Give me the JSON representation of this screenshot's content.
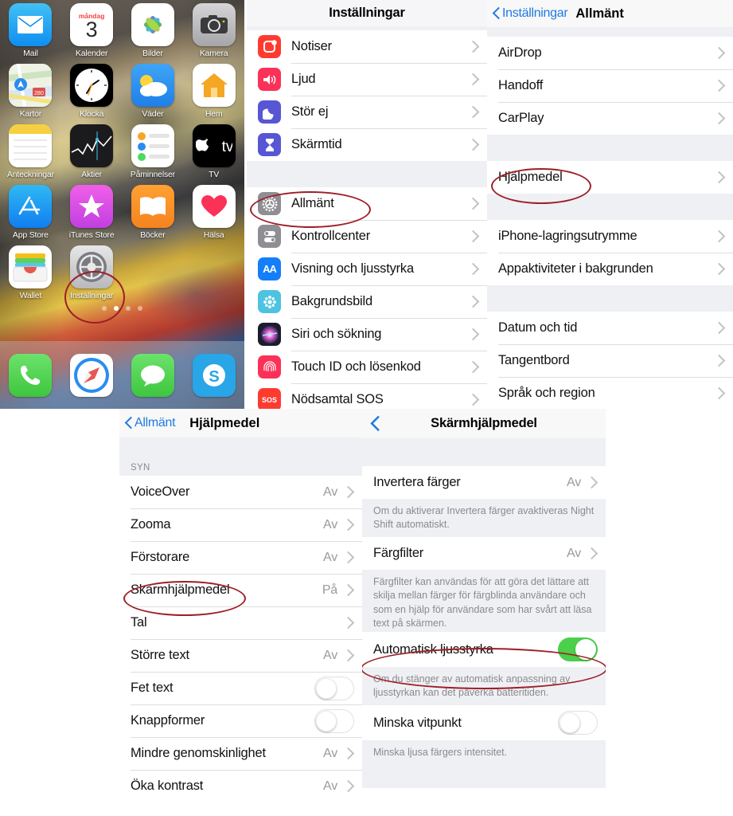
{
  "homescreen": {
    "wallpaper_desc": "photo of a colorful painted van",
    "rows": [
      [
        {
          "label": "Mail",
          "icon": "mail-icon"
        },
        {
          "label": "Kalender",
          "icon": "calendar-icon",
          "weekday": "måndag",
          "day": "3"
        },
        {
          "label": "Bilder",
          "icon": "photos-icon"
        },
        {
          "label": "Kamera",
          "icon": "camera-icon"
        }
      ],
      [
        {
          "label": "Kartor",
          "icon": "maps-icon"
        },
        {
          "label": "Klocka",
          "icon": "clock-icon"
        },
        {
          "label": "Väder",
          "icon": "weather-icon"
        },
        {
          "label": "Hem",
          "icon": "home-icon"
        }
      ],
      [
        {
          "label": "Anteckningar",
          "icon": "notes-icon"
        },
        {
          "label": "Aktier",
          "icon": "stocks-icon"
        },
        {
          "label": "Påminnelser",
          "icon": "reminders-icon"
        },
        {
          "label": "TV",
          "icon": "tv-icon"
        }
      ],
      [
        {
          "label": "App Store",
          "icon": "appstore-icon"
        },
        {
          "label": "iTunes Store",
          "icon": "itunes-icon"
        },
        {
          "label": "Böcker",
          "icon": "books-icon"
        },
        {
          "label": "Hälsa",
          "icon": "health-icon"
        }
      ],
      [
        {
          "label": "Wallet",
          "icon": "wallet-icon"
        },
        {
          "label": "Inställningar",
          "icon": "settings-gear-icon"
        },
        {
          "label": "",
          "icon": "empty-slot"
        },
        {
          "label": "",
          "icon": "empty-slot"
        }
      ]
    ],
    "page_dots": 4,
    "active_dot": 2,
    "dock": [
      {
        "label": "Telefon",
        "icon": "phone-icon"
      },
      {
        "label": "Safari",
        "icon": "safari-icon"
      },
      {
        "label": "Meddelanden",
        "icon": "messages-icon"
      },
      {
        "label": "Skype",
        "icon": "skype-icon"
      }
    ]
  },
  "settings": {
    "title": "Inställningar",
    "groups": [
      {
        "rows": [
          {
            "label": "Notiser",
            "icon": "notifications-icon",
            "color": "#ff3b30"
          },
          {
            "label": "Ljud",
            "icon": "sounds-icon",
            "color": "#fc3158"
          },
          {
            "label": "Stör ej",
            "icon": "do-not-disturb-icon",
            "color": "#5756d5"
          },
          {
            "label": "Skärmtid",
            "icon": "screen-time-icon",
            "color": "#5756d5"
          }
        ]
      },
      {
        "rows": [
          {
            "label": "Allmänt",
            "icon": "general-gear-icon",
            "color": "#8e8e93",
            "highlighted": true
          },
          {
            "label": "Kontrollcenter",
            "icon": "control-center-icon",
            "color": "#8e8e93"
          },
          {
            "label": "Visning och ljusstyrka",
            "icon": "display-brightness-icon",
            "color": "#147efb"
          },
          {
            "label": "Bakgrundsbild",
            "icon": "wallpaper-icon",
            "color": "#4cc3e0"
          },
          {
            "label": "Siri och sökning",
            "icon": "siri-icon",
            "color": "#1c1c2e"
          },
          {
            "label": "Touch ID och lösenkod",
            "icon": "touch-id-icon",
            "color": "#fc3158"
          },
          {
            "label": "Nödsamtal SOS",
            "icon": "sos-icon",
            "color": "#ff3b30"
          }
        ]
      }
    ]
  },
  "general": {
    "back_label": "Inställningar",
    "title": "Allmänt",
    "groups": [
      {
        "rows": [
          {
            "label": "AirDrop"
          },
          {
            "label": "Handoff"
          },
          {
            "label": "CarPlay"
          }
        ]
      },
      {
        "rows": [
          {
            "label": "Hjälpmedel",
            "highlighted": true
          }
        ]
      },
      {
        "rows": [
          {
            "label": "iPhone-lagringsutrymme"
          },
          {
            "label": "Appaktiviteter i bakgrunden"
          }
        ]
      },
      {
        "rows": [
          {
            "label": "Datum och tid"
          },
          {
            "label": "Tangentbord"
          },
          {
            "label": "Språk och region"
          }
        ]
      }
    ]
  },
  "accessibility": {
    "back_label": "Allmänt",
    "title": "Hjälpmedel",
    "section_header": "SYN",
    "rows": [
      {
        "label": "VoiceOver",
        "value": "Av",
        "type": "link"
      },
      {
        "label": "Zooma",
        "value": "Av",
        "type": "link"
      },
      {
        "label": "Förstorare",
        "value": "Av",
        "type": "link"
      },
      {
        "label": "Skärmhjälpmedel",
        "value": "På",
        "type": "link",
        "highlighted": true
      },
      {
        "label": "Tal",
        "value": "",
        "type": "link"
      },
      {
        "label": "Större text",
        "value": "Av",
        "type": "link"
      },
      {
        "label": "Fet text",
        "value": "",
        "type": "toggle",
        "on": false
      },
      {
        "label": "Knappformer",
        "value": "",
        "type": "toggle",
        "on": false
      },
      {
        "label": "Mindre genomskinlighet",
        "value": "Av",
        "type": "link"
      },
      {
        "label": "Öka kontrast",
        "value": "Av",
        "type": "link"
      }
    ]
  },
  "display_accommodations": {
    "back_label": "",
    "title": "Skärmhjälpmedel",
    "items": [
      {
        "label": "Invertera färger",
        "value": "Av",
        "type": "link",
        "footnote": "Om du aktiverar Invertera färger avaktiveras Night Shift automatiskt."
      },
      {
        "label": "Färgfilter",
        "value": "Av",
        "type": "link",
        "footnote": "Färgfilter kan användas för att göra det lättare att skilja mellan färger för färgblinda användare och som en hjälp för användare som har svårt att läsa text på skärmen."
      },
      {
        "label": "Automatisk ljusstyrka",
        "value": "",
        "type": "toggle",
        "on": true,
        "highlighted": true,
        "footnote": "Om du stänger av automatisk anpassning av ljusstyrkan kan det påverka batteritiden."
      },
      {
        "label": "Minska vitpunkt",
        "value": "",
        "type": "toggle",
        "on": false,
        "footnote": "Minska ljusa färgers intensitet."
      }
    ]
  },
  "annotations": {
    "color": "#9d1f28",
    "marks": [
      {
        "target": "settings-app-icon-home"
      },
      {
        "target": "settings-row-allmant"
      },
      {
        "target": "general-row-hjalpmedel"
      },
      {
        "target": "accessibility-row-skarmhjalpmedel"
      },
      {
        "target": "display-row-automatisk-ljusstyrka"
      }
    ]
  }
}
